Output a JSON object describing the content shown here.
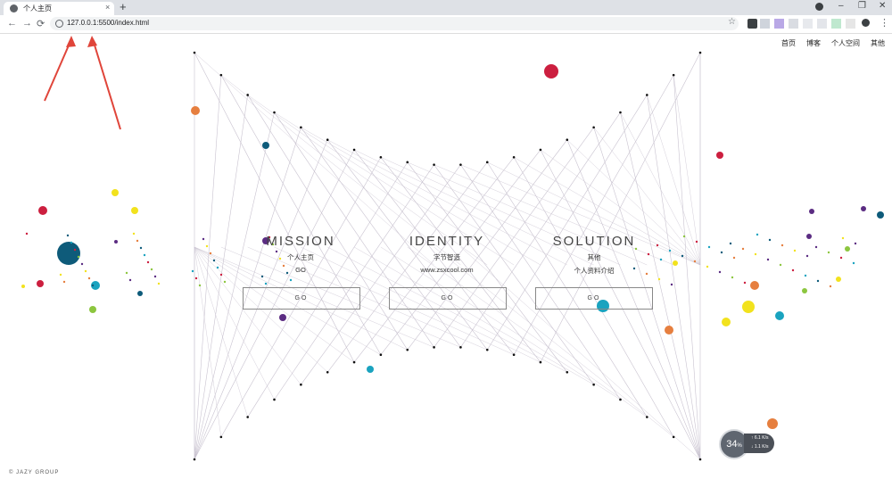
{
  "browser": {
    "tab_title": "个人主页",
    "tab_close": "×",
    "new_tab": "+",
    "url": "127.0.0.1:5500/index.html",
    "nav": {
      "back": "←",
      "forward": "→",
      "reload": "⟳"
    },
    "star": "☆",
    "menu": "⋮",
    "window": {
      "minimize": "–",
      "restore": "❐",
      "close": "✕"
    }
  },
  "site_nav": [
    "首页",
    "博客",
    "个人空间",
    "其他"
  ],
  "cards": [
    {
      "title": "MISSION",
      "line1": "个人主页",
      "line2": "GO",
      "button": "GO"
    },
    {
      "title": "IDENTITY",
      "line1": "字节智造",
      "line2": "www.zsxcool.com",
      "button": "GO"
    },
    {
      "title": "SOLUTION",
      "line1": "其他",
      "line2": "个人资料介绍",
      "button": "GO"
    }
  ],
  "footer": "© JAZY GROUP",
  "speed_widget": {
    "percent": "34",
    "unit": "%",
    "up": "6.1",
    "down": "1.1",
    "rate_unit": "K/s"
  },
  "colors": {
    "accent_line": "#c9c3d0",
    "crimson": "#cc1f3f",
    "teal": "#1aa3bf",
    "navy": "#0e5b7a",
    "orange": "#e67f3f",
    "yellow": "#f2e21d",
    "purple": "#5b2c82",
    "green": "#8cc63f"
  }
}
